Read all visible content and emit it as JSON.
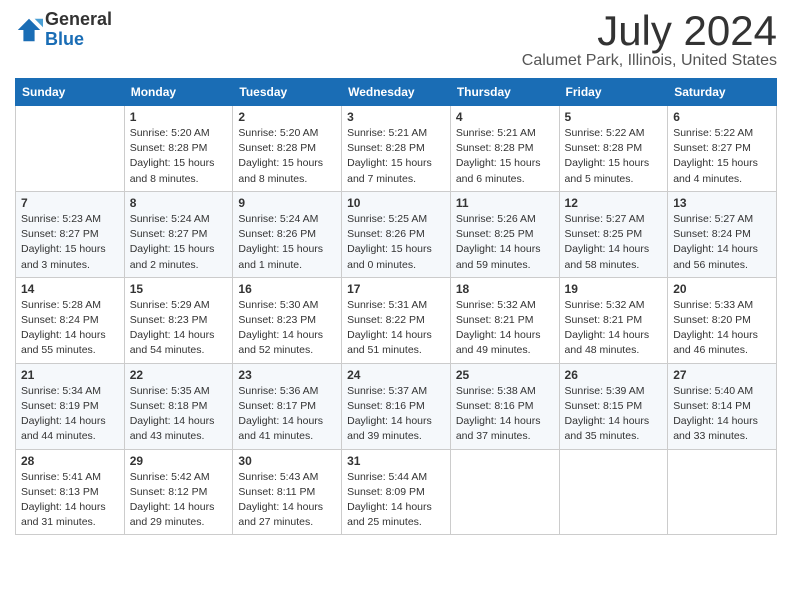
{
  "header": {
    "logo_general": "General",
    "logo_blue": "Blue",
    "month": "July 2024",
    "location": "Calumet Park, Illinois, United States"
  },
  "columns": [
    "Sunday",
    "Monday",
    "Tuesday",
    "Wednesday",
    "Thursday",
    "Friday",
    "Saturday"
  ],
  "weeks": [
    [
      {
        "day": "",
        "info": ""
      },
      {
        "day": "1",
        "info": "Sunrise: 5:20 AM\nSunset: 8:28 PM\nDaylight: 15 hours\nand 8 minutes."
      },
      {
        "day": "2",
        "info": "Sunrise: 5:20 AM\nSunset: 8:28 PM\nDaylight: 15 hours\nand 8 minutes."
      },
      {
        "day": "3",
        "info": "Sunrise: 5:21 AM\nSunset: 8:28 PM\nDaylight: 15 hours\nand 7 minutes."
      },
      {
        "day": "4",
        "info": "Sunrise: 5:21 AM\nSunset: 8:28 PM\nDaylight: 15 hours\nand 6 minutes."
      },
      {
        "day": "5",
        "info": "Sunrise: 5:22 AM\nSunset: 8:28 PM\nDaylight: 15 hours\nand 5 minutes."
      },
      {
        "day": "6",
        "info": "Sunrise: 5:22 AM\nSunset: 8:27 PM\nDaylight: 15 hours\nand 4 minutes."
      }
    ],
    [
      {
        "day": "7",
        "info": "Sunrise: 5:23 AM\nSunset: 8:27 PM\nDaylight: 15 hours\nand 3 minutes."
      },
      {
        "day": "8",
        "info": "Sunrise: 5:24 AM\nSunset: 8:27 PM\nDaylight: 15 hours\nand 2 minutes."
      },
      {
        "day": "9",
        "info": "Sunrise: 5:24 AM\nSunset: 8:26 PM\nDaylight: 15 hours\nand 1 minute."
      },
      {
        "day": "10",
        "info": "Sunrise: 5:25 AM\nSunset: 8:26 PM\nDaylight: 15 hours\nand 0 minutes."
      },
      {
        "day": "11",
        "info": "Sunrise: 5:26 AM\nSunset: 8:25 PM\nDaylight: 14 hours\nand 59 minutes."
      },
      {
        "day": "12",
        "info": "Sunrise: 5:27 AM\nSunset: 8:25 PM\nDaylight: 14 hours\nand 58 minutes."
      },
      {
        "day": "13",
        "info": "Sunrise: 5:27 AM\nSunset: 8:24 PM\nDaylight: 14 hours\nand 56 minutes."
      }
    ],
    [
      {
        "day": "14",
        "info": "Sunrise: 5:28 AM\nSunset: 8:24 PM\nDaylight: 14 hours\nand 55 minutes."
      },
      {
        "day": "15",
        "info": "Sunrise: 5:29 AM\nSunset: 8:23 PM\nDaylight: 14 hours\nand 54 minutes."
      },
      {
        "day": "16",
        "info": "Sunrise: 5:30 AM\nSunset: 8:23 PM\nDaylight: 14 hours\nand 52 minutes."
      },
      {
        "day": "17",
        "info": "Sunrise: 5:31 AM\nSunset: 8:22 PM\nDaylight: 14 hours\nand 51 minutes."
      },
      {
        "day": "18",
        "info": "Sunrise: 5:32 AM\nSunset: 8:21 PM\nDaylight: 14 hours\nand 49 minutes."
      },
      {
        "day": "19",
        "info": "Sunrise: 5:32 AM\nSunset: 8:21 PM\nDaylight: 14 hours\nand 48 minutes."
      },
      {
        "day": "20",
        "info": "Sunrise: 5:33 AM\nSunset: 8:20 PM\nDaylight: 14 hours\nand 46 minutes."
      }
    ],
    [
      {
        "day": "21",
        "info": "Sunrise: 5:34 AM\nSunset: 8:19 PM\nDaylight: 14 hours\nand 44 minutes."
      },
      {
        "day": "22",
        "info": "Sunrise: 5:35 AM\nSunset: 8:18 PM\nDaylight: 14 hours\nand 43 minutes."
      },
      {
        "day": "23",
        "info": "Sunrise: 5:36 AM\nSunset: 8:17 PM\nDaylight: 14 hours\nand 41 minutes."
      },
      {
        "day": "24",
        "info": "Sunrise: 5:37 AM\nSunset: 8:16 PM\nDaylight: 14 hours\nand 39 minutes."
      },
      {
        "day": "25",
        "info": "Sunrise: 5:38 AM\nSunset: 8:16 PM\nDaylight: 14 hours\nand 37 minutes."
      },
      {
        "day": "26",
        "info": "Sunrise: 5:39 AM\nSunset: 8:15 PM\nDaylight: 14 hours\nand 35 minutes."
      },
      {
        "day": "27",
        "info": "Sunrise: 5:40 AM\nSunset: 8:14 PM\nDaylight: 14 hours\nand 33 minutes."
      }
    ],
    [
      {
        "day": "28",
        "info": "Sunrise: 5:41 AM\nSunset: 8:13 PM\nDaylight: 14 hours\nand 31 minutes."
      },
      {
        "day": "29",
        "info": "Sunrise: 5:42 AM\nSunset: 8:12 PM\nDaylight: 14 hours\nand 29 minutes."
      },
      {
        "day": "30",
        "info": "Sunrise: 5:43 AM\nSunset: 8:11 PM\nDaylight: 14 hours\nand 27 minutes."
      },
      {
        "day": "31",
        "info": "Sunrise: 5:44 AM\nSunset: 8:09 PM\nDaylight: 14 hours\nand 25 minutes."
      },
      {
        "day": "",
        "info": ""
      },
      {
        "day": "",
        "info": ""
      },
      {
        "day": "",
        "info": ""
      }
    ]
  ]
}
